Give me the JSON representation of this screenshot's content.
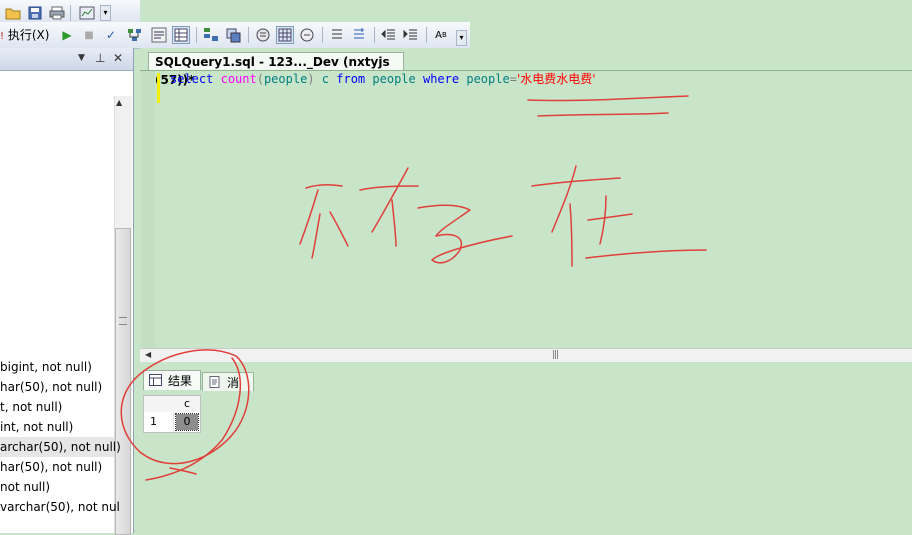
{
  "toolbar": {
    "execute_label": "执行(X)",
    "icons": [
      "open-icon",
      "save-icon",
      "print-icon",
      "report-icon",
      "execute-icon",
      "debug-icon",
      "stop-icon",
      "parse-icon"
    ]
  },
  "object_explorer": {
    "columns": [
      " bigint, not null)",
      "har(50), not null)",
      "t, not null)",
      "int, not null)",
      "archar(50), not null)",
      "har(50), not null)",
      " not null)",
      "varchar(50), not nul"
    ],
    "selected_index": 4
  },
  "editor": {
    "tab_title": "SQLQuery1.sql - 123..._Dev (nxtyjs (57))*",
    "sql": {
      "kw_select": "select",
      "fn_count": "count",
      "paren_open": "(",
      "arg": "people",
      "paren_close": ")",
      "alias": "c",
      "kw_from": "from",
      "table": "people",
      "kw_where": "where",
      "col": "people",
      "eq": "=",
      "string": "'水电费水电费'"
    }
  },
  "results": {
    "tab_results": "结果",
    "tab_messages": "消息",
    "column_header": "c",
    "row_number": "1",
    "cell_value": "0"
  },
  "colors": {
    "editor_bg": "#c9e5c9",
    "annotation": "#e0403a",
    "keyword": "#0000ff",
    "string": "#ff0000"
  }
}
